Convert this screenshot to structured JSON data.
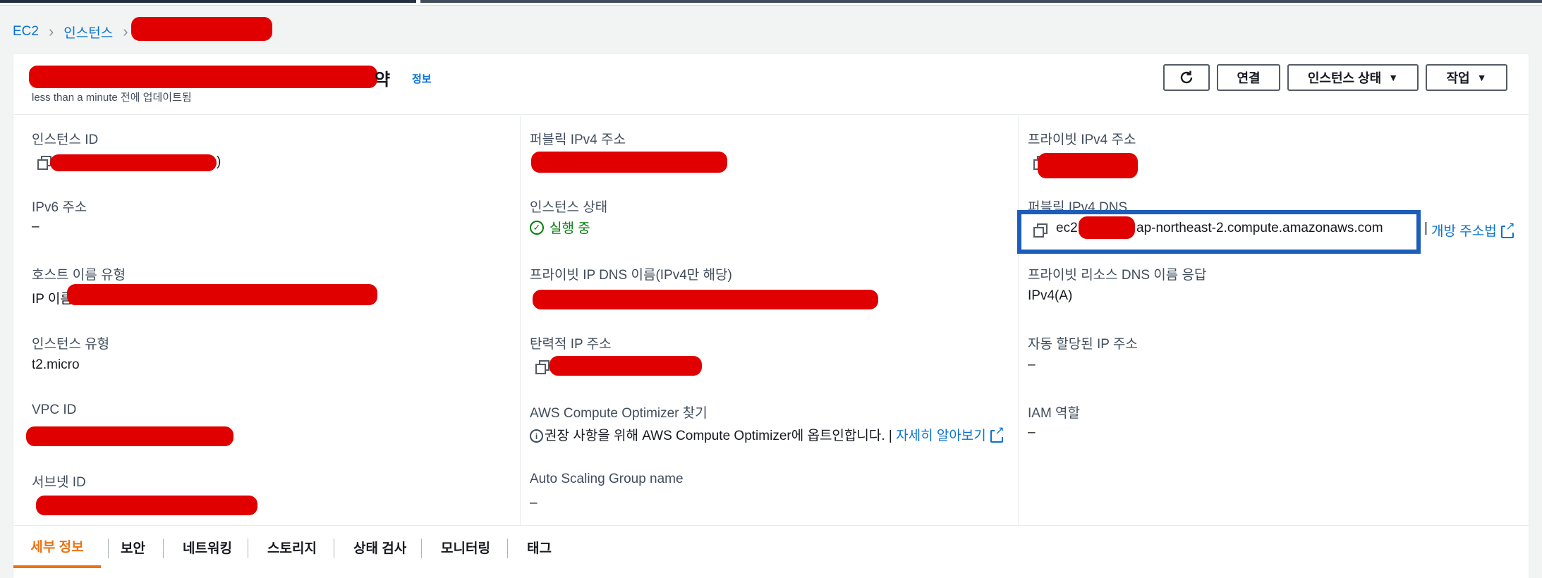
{
  "breadcrumb": {
    "root": "EC2",
    "instances": "인스턴스"
  },
  "header": {
    "title_suffix": "약",
    "info_label": "정보",
    "subtitle": "less than a minute 전에 업데이트됨"
  },
  "buttons": {
    "connect": "연결",
    "instance_state": "인스턴스 상태",
    "actions": "작업"
  },
  "fields": {
    "instance_id_label": "인스턴스 ID",
    "instance_id_tail": ")",
    "public_ipv4_label": "퍼블릭 IPv4 주소",
    "private_ipv4_label": "프라이빗 IPv4 주소",
    "ipv6_label": "IPv6 주소",
    "ipv6_value": "–",
    "instance_state_label": "인스턴스 상태",
    "instance_state_value": "실행 중",
    "public_dns_label": "퍼블릭 IPv4 DNS",
    "public_dns_prefix": "ec2",
    "public_dns_suffix": "ap-northeast-2.compute.amazonaws.com",
    "public_dns_sep": "|",
    "public_dns_open": "개방 주소법",
    "hostname_type_label": "호스트 이름 유형",
    "hostname_type_prefix": "IP 이름",
    "private_dns_label": "프라이빗 IP DNS 이름(IPv4만 해당)",
    "private_resource_dns_label": "프라이빗 리소스 DNS 이름 응답",
    "private_resource_dns_value": "IPv4(A)",
    "instance_type_label": "인스턴스 유형",
    "instance_type_value": "t2.micro",
    "elastic_ip_label": "탄력적 IP 주소",
    "auto_ip_label": "자동 할당된 IP 주소",
    "auto_ip_value": "–",
    "vpc_id_label": "VPC ID",
    "optimizer_label": "AWS Compute Optimizer 찾기",
    "optimizer_text": "권장 사항을 위해 AWS Compute Optimizer에 옵트인합니다. |",
    "optimizer_link": "자세히 알아보기",
    "iam_role_label": "IAM 역할",
    "iam_role_value": "–",
    "subnet_id_label": "서브넷 ID",
    "asg_label": "Auto Scaling Group name",
    "asg_value": "–"
  },
  "tabs": [
    "세부 정보",
    "보안",
    "네트워킹",
    "스토리지",
    "상태 검사",
    "모니터링",
    "태그"
  ],
  "colors": {
    "accent": "#ec7211",
    "link": "#0972d3",
    "success": "#037f0c",
    "highlight": "#1b5db8",
    "redaction": "#e00000"
  }
}
